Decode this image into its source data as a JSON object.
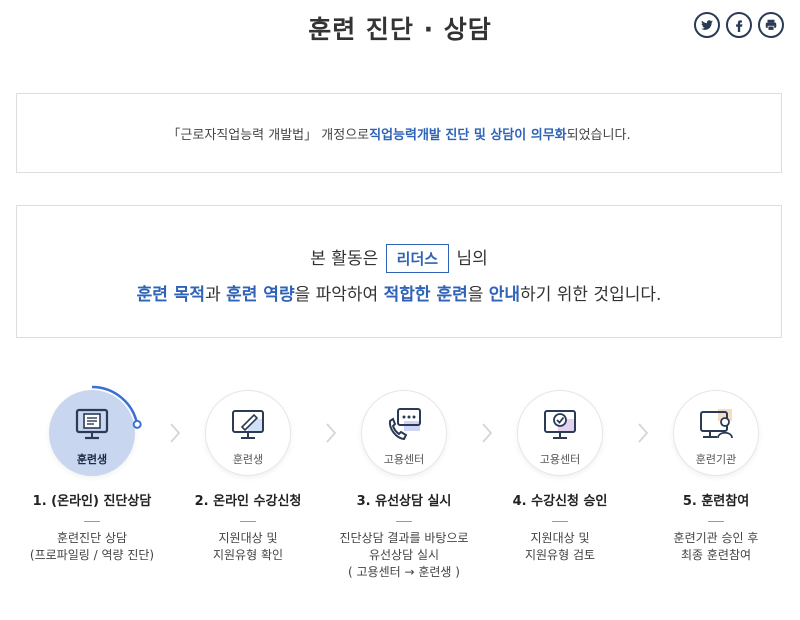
{
  "page": {
    "title": "훈련 진단 · 상담"
  },
  "share": [
    {
      "name": "twitter-icon"
    },
    {
      "name": "facebook-icon"
    },
    {
      "name": "print-icon"
    }
  ],
  "notice": {
    "text_before": "「근로자직업능력 개발법」 개정으로 ",
    "highlight": "직업능력개발 진단 및 상담이 의무화",
    "text_after": " 되었습니다."
  },
  "purpose": {
    "line1_before": "본 활동은",
    "name": "리더스",
    "line1_after": "님의",
    "line2": [
      {
        "text": "훈련 목적",
        "hl": true
      },
      {
        "text": "과 ",
        "hl": false
      },
      {
        "text": "훈련 역량",
        "hl": true
      },
      {
        "text": "을 파악하여 ",
        "hl": false
      },
      {
        "text": "적합한 훈련",
        "hl": true
      },
      {
        "text": "을 ",
        "hl": false
      },
      {
        "text": "안내",
        "hl": true
      },
      {
        "text": "하기 위한 것입니다.",
        "hl": false
      }
    ]
  },
  "steps": [
    {
      "icon": "monitor-document-icon",
      "who": "훈련생",
      "title": "1. (온라인) 진단상담",
      "desc": [
        "훈련진단 상담",
        "(프로파일링 / 역량 진단)"
      ],
      "active": true,
      "progress": 0.22
    },
    {
      "icon": "monitor-pen-icon",
      "who": "훈련생",
      "title": "2. 온라인 수강신청",
      "desc": [
        "지원대상 및",
        "지원유형 확인"
      ],
      "active": false
    },
    {
      "icon": "phone-chat-icon",
      "who": "고용센터",
      "title": "3. 유선상담 실시",
      "desc": [
        "진단상담 결과를 바탕으로",
        "유선상담 실시",
        "( 고용센터 → 훈련생 )"
      ],
      "active": false
    },
    {
      "icon": "monitor-check-icon",
      "who": "고용센터",
      "title": "4. 수강신청 승인",
      "desc": [
        "지원대상 및",
        "지원유형 검토"
      ],
      "active": false
    },
    {
      "icon": "monitor-person-icon",
      "who": "훈련기관",
      "title": "5. 훈련참여",
      "desc": [
        "훈련기관 승인 후",
        "최종 훈련참여"
      ],
      "active": false
    }
  ],
  "colors": {
    "accent": "#2f63b8",
    "active_circle": "#c9d6ef",
    "icon_dark": "#2b3a55",
    "progress": "#3b6fd6"
  }
}
